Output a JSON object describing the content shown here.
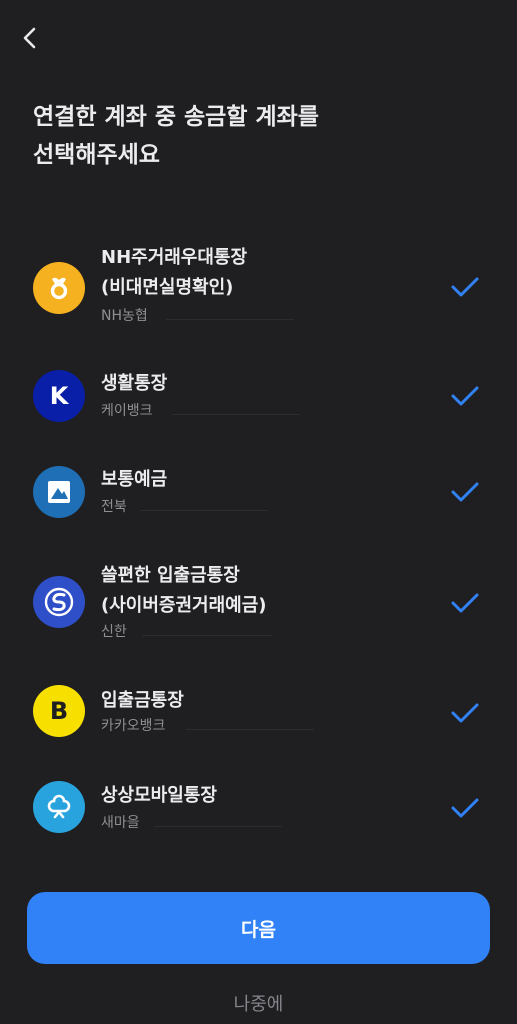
{
  "header": {
    "back_icon": "chevron-left-icon"
  },
  "title": {
    "line1": "연결한 계좌 중 송금할 계좌를",
    "line2": "선택해주세요"
  },
  "accounts": [
    {
      "name_line1": "NH주거래우대통장",
      "name_line2": "(비대면실명확인)",
      "bank": "NH농협",
      "logo_icon": "nh-bank-logo-icon",
      "logo_color": "#f5b120",
      "selected": true
    },
    {
      "name_line1": "생활통장",
      "name_line2": "",
      "bank": "케이뱅크",
      "logo_icon": "kbank-logo-icon",
      "logo_letter": "K",
      "logo_color": "#0a1fa8",
      "selected": true
    },
    {
      "name_line1": "보통예금",
      "name_line2": "",
      "bank": "전북",
      "logo_icon": "jb-bank-logo-icon",
      "logo_color": "#1e6fb5",
      "selected": true
    },
    {
      "name_line1": "쓸편한 입출금통장",
      "name_line2": "(사이버증권거래예금)",
      "bank": "신한",
      "logo_icon": "shinhan-logo-icon",
      "logo_color": "#2f4fc9",
      "selected": true
    },
    {
      "name_line1": "입출금통장",
      "name_line2": "",
      "bank": "카카오뱅크",
      "logo_icon": "kakaobank-logo-icon",
      "logo_letter": "B",
      "logo_color": "#f7e000",
      "selected": true
    },
    {
      "name_line1": "상상모바일통장",
      "name_line2": "",
      "bank": "새마을",
      "logo_icon": "mg-logo-icon",
      "logo_color": "#29a3dd",
      "selected": true
    }
  ],
  "check_color": "#3182f6",
  "buttons": {
    "next_label": "다음",
    "later_label": "나중에"
  }
}
